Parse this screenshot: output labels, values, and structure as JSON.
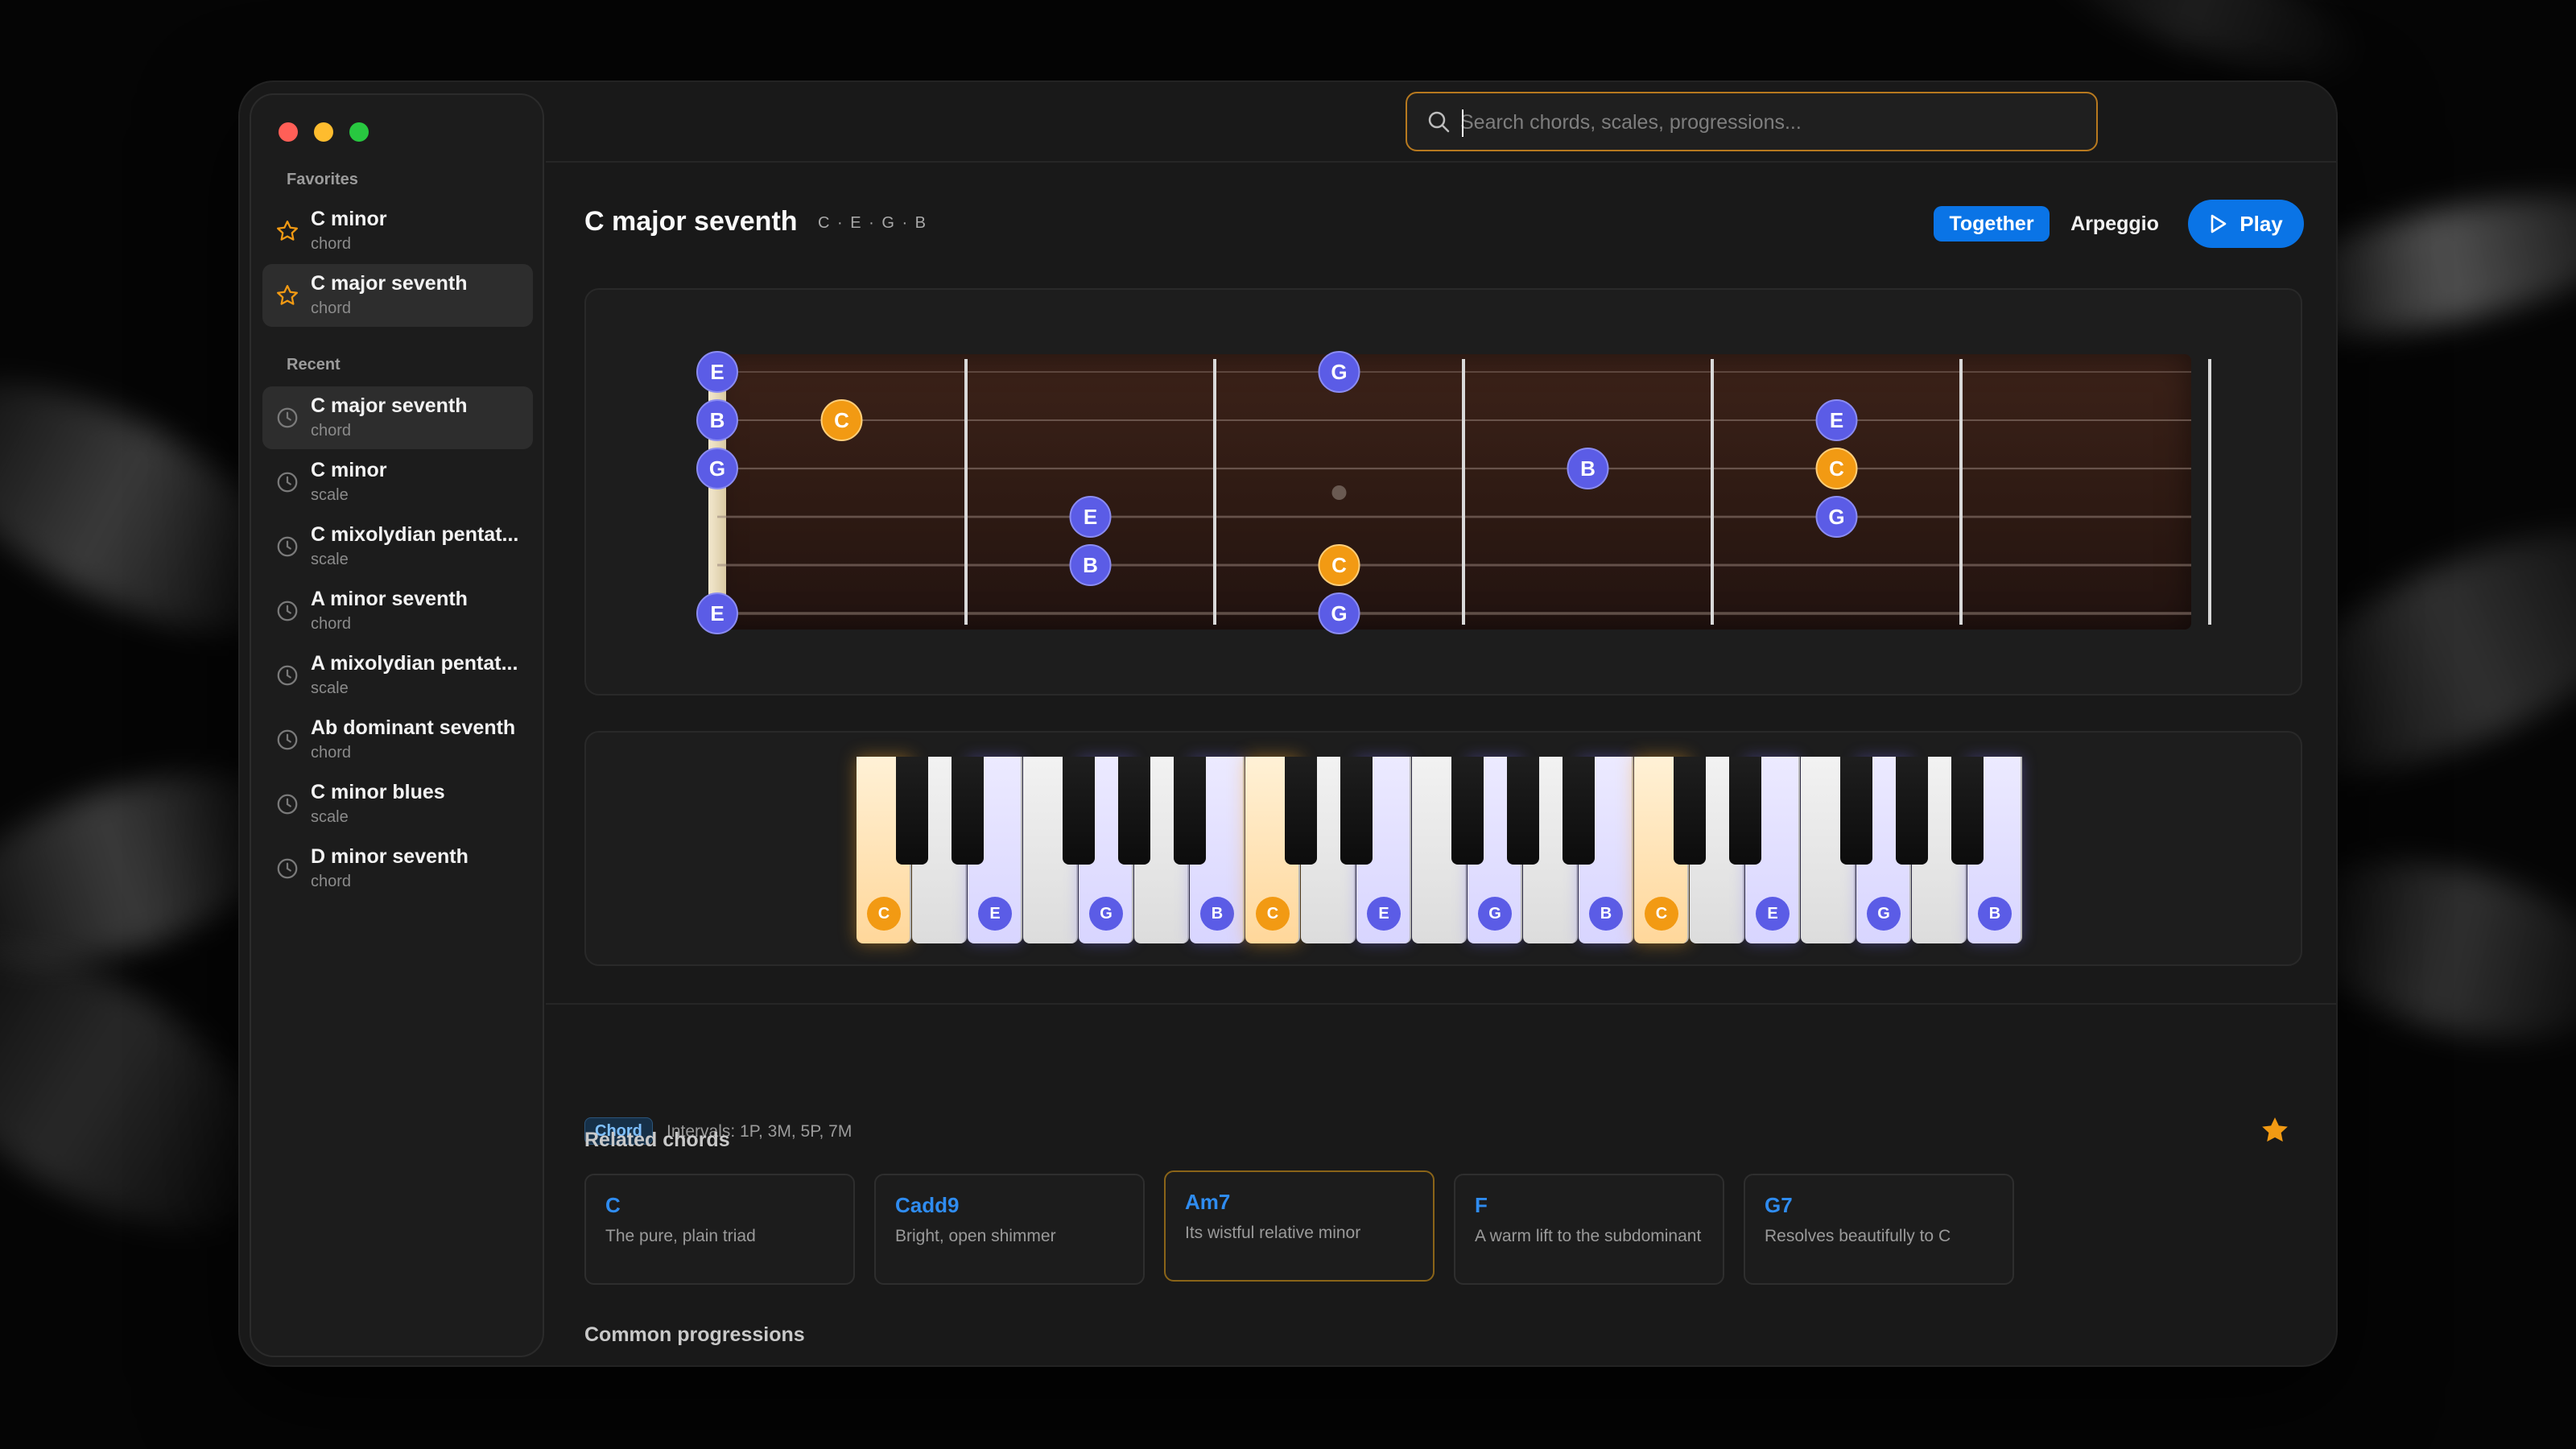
{
  "search": {
    "placeholder": "Search chords, scales, progressions..."
  },
  "sidebar": {
    "favorites_label": "Favorites",
    "recent_label": "Recent",
    "favorites": [
      {
        "name": "C minor",
        "kind": "chord"
      },
      {
        "name": "C major seventh",
        "kind": "chord"
      }
    ],
    "recent": [
      {
        "name": "C major seventh",
        "kind": "chord"
      },
      {
        "name": "C minor",
        "kind": "scale"
      },
      {
        "name": "C mixolydian pentat...",
        "kind": "scale"
      },
      {
        "name": "A minor seventh",
        "kind": "chord"
      },
      {
        "name": "A mixolydian pentat...",
        "kind": "scale"
      },
      {
        "name": "Ab dominant seventh",
        "kind": "chord"
      },
      {
        "name": "C minor blues",
        "kind": "scale"
      },
      {
        "name": "D minor seventh",
        "kind": "chord"
      }
    ]
  },
  "main": {
    "title": "C major seventh",
    "notes": "C · E · G · B",
    "mode_together": "Together",
    "mode_arpeggio": "Arpeggio",
    "play_label": "Play",
    "badge": "Chord",
    "intervals": "Intervals: 1P, 3M, 5P, 7M",
    "related_heading": "Related chords",
    "progressions_heading": "Common progressions",
    "related": [
      {
        "name": "C",
        "desc": "The pure, plain triad"
      },
      {
        "name": "Cadd9",
        "desc": "Bright, open shimmer"
      },
      {
        "name": "Am7",
        "desc": "Its wistful relative minor"
      },
      {
        "name": "F",
        "desc": "A warm lift to the subdominant"
      },
      {
        "name": "G7",
        "desc": "Resolves beautifully to C"
      }
    ]
  },
  "fretboard": {
    "strings": 6,
    "frets": 6,
    "position_marker_fret": 3,
    "notes": [
      {
        "string": 1,
        "fret": 0,
        "note": "E",
        "root": false
      },
      {
        "string": 2,
        "fret": 0,
        "note": "B",
        "root": false
      },
      {
        "string": 3,
        "fret": 0,
        "note": "G",
        "root": false
      },
      {
        "string": 6,
        "fret": 0,
        "note": "E",
        "root": false
      },
      {
        "string": 2,
        "fret": 1,
        "note": "C",
        "root": true
      },
      {
        "string": 4,
        "fret": 2,
        "note": "E",
        "root": false
      },
      {
        "string": 5,
        "fret": 2,
        "note": "B",
        "root": false
      },
      {
        "string": 1,
        "fret": 3,
        "note": "G",
        "root": false
      },
      {
        "string": 5,
        "fret": 3,
        "note": "C",
        "root": true
      },
      {
        "string": 6,
        "fret": 3,
        "note": "G",
        "root": false
      },
      {
        "string": 3,
        "fret": 4,
        "note": "B",
        "root": false
      },
      {
        "string": 2,
        "fret": 5,
        "note": "E",
        "root": false
      },
      {
        "string": 3,
        "fret": 5,
        "note": "C",
        "root": true
      },
      {
        "string": 4,
        "fret": 5,
        "note": "G",
        "root": false
      }
    ]
  },
  "piano": {
    "white_keys": [
      "C",
      "D",
      "E",
      "F",
      "G",
      "A",
      "B",
      "C",
      "D",
      "E",
      "F",
      "G",
      "A",
      "B",
      "C",
      "D",
      "E",
      "F",
      "G",
      "A",
      "B"
    ],
    "highlighted": [
      {
        "white_index": 0,
        "note": "C",
        "root": true
      },
      {
        "white_index": 2,
        "note": "E",
        "root": false
      },
      {
        "white_index": 4,
        "note": "G",
        "root": false
      },
      {
        "white_index": 6,
        "note": "B",
        "root": false
      },
      {
        "white_index": 7,
        "note": "C",
        "root": true
      },
      {
        "white_index": 9,
        "note": "E",
        "root": false
      },
      {
        "white_index": 11,
        "note": "G",
        "root": false
      },
      {
        "white_index": 13,
        "note": "B",
        "root": false
      },
      {
        "white_index": 14,
        "note": "C",
        "root": true
      },
      {
        "white_index": 16,
        "note": "E",
        "root": false
      },
      {
        "white_index": 18,
        "note": "G",
        "root": false
      },
      {
        "white_index": 20,
        "note": "B",
        "root": false
      }
    ]
  },
  "colors": {
    "accent_blue": "#0a74e6",
    "root_orange": "#f29a13",
    "note_indigo": "#5b5ce6",
    "star_orange": "#f29a13"
  }
}
